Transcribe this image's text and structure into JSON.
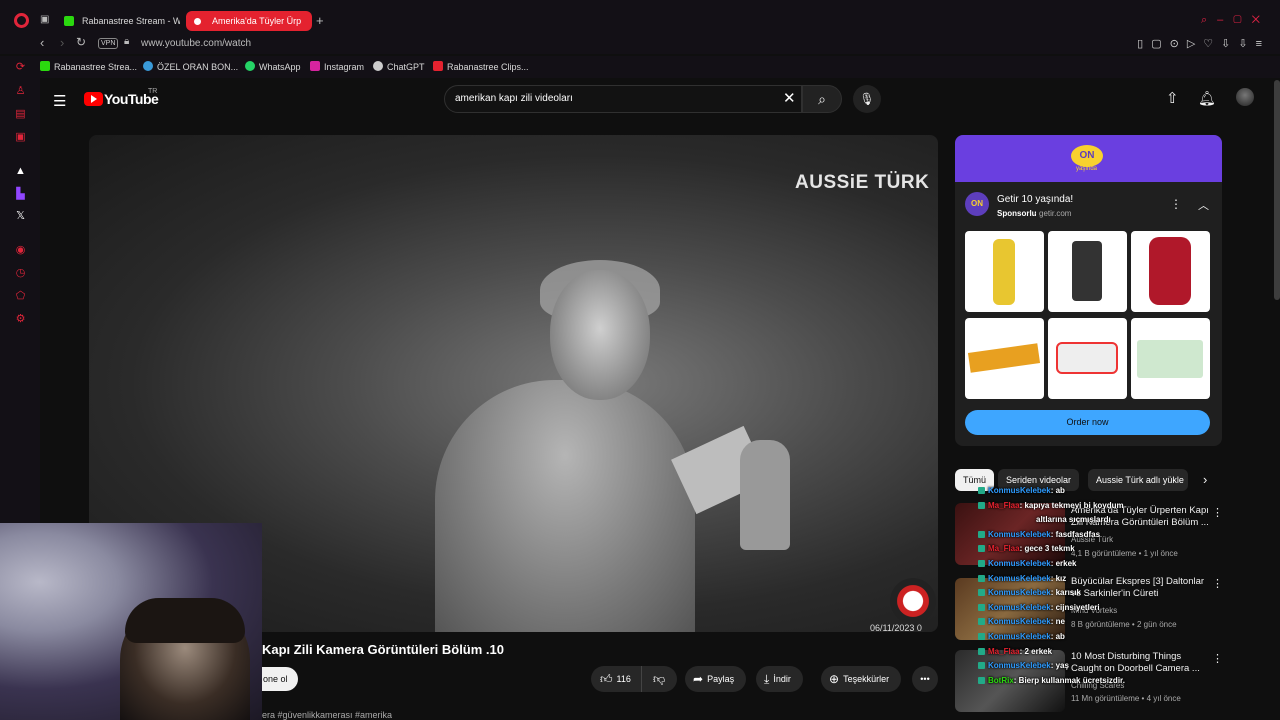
{
  "browser": {
    "tabs": [
      {
        "label": "Rabanastree Stream - Wa",
        "color": "#2bd90f"
      },
      {
        "label": "Amerika'da Tüyler Ürp",
        "color": "#e4222f"
      }
    ],
    "vpn_label": "VPN",
    "url": "www.youtube.com/watch",
    "bookmarks": [
      {
        "label": "Rabanastree Strea...",
        "color": "#2bd90f"
      },
      {
        "label": "ÖZEL ORAN BON...",
        "color": "#3a9ad9"
      },
      {
        "label": "WhatsApp",
        "color": "#25d366"
      },
      {
        "label": "Instagram",
        "color": "#d6249f"
      },
      {
        "label": "ChatGPT",
        "color": "#cccccc"
      },
      {
        "label": "Rabanastree Clips...",
        "color": "#e4222f"
      }
    ]
  },
  "youtube": {
    "logo_text": "YouTube",
    "country_code": "TR",
    "search_query": "amerikan kapı zili videoları",
    "video": {
      "watermark": "AUSSiE TÜRK",
      "overlay_timestamp": "06/11/2023 0",
      "title": "Kapı Zili Kamera Görüntüleri Bölüm .10",
      "subscribe_label": "Abone ol",
      "subscribe_visible": "one ol",
      "likes": "116",
      "share_label": "Paylaş",
      "download_label": "İndir",
      "thanks_label": "Teşekkürler",
      "description": "era #güvenlikkamerası #amerika"
    },
    "ad": {
      "banner_logo": "ON",
      "banner_sub": "yaşında",
      "title": "Getir 10 yaşında!",
      "sponsored": "Sponsorlu",
      "domain": "getir.com",
      "cta": "Order now"
    },
    "chips": [
      "Tümü",
      "Seriden videolar",
      "Aussie Türk adlı yükle"
    ],
    "related": [
      {
        "title": "Amerika'da Tüyler Ürperten Kapı Zili Kamera Görüntüleri Bölüm ...",
        "channel": "Aussie Türk",
        "meta": "4,1 B görüntüleme • 1 yıl önce"
      },
      {
        "title": "Büyücülar Ekspres [3] Daltonlar ve Sarkinler'in Cüreti",
        "channel": "Mind Vorteks",
        "meta": "8 B görüntüleme • 2 gün önce"
      },
      {
        "title": "10 Most Disturbing Things Caught on Doorbell Camera ...",
        "channel": "Chilling Scares",
        "meta": "11 Mn görüntüleme • 4 yıl önce"
      }
    ]
  },
  "chat": [
    {
      "user": "KonmusKelebek",
      "text": ": ab",
      "color": "#2e9cff"
    },
    {
      "user": "Ma_Flaa",
      "text": ": kapıya tekmeyi bi koydum",
      "color": "#e4222f"
    },
    {
      "user": "",
      "text": "altlarına sıçmışlardı",
      "color": "#ffffff"
    },
    {
      "user": "KonmusKelebek",
      "text": ": fasdfasdfas",
      "color": "#2e9cff"
    },
    {
      "user": "Ma_Flaa",
      "text": ": gece 3 tekmk",
      "color": "#e4222f"
    },
    {
      "user": "KonmusKelebek",
      "text": ": erkek",
      "color": "#2e9cff"
    },
    {
      "user": "KonmusKelebek",
      "text": ": kız",
      "color": "#2e9cff"
    },
    {
      "user": "KonmusKelebek",
      "text": ": karısık",
      "color": "#2e9cff"
    },
    {
      "user": "KonmusKelebek",
      "text": ": cijnsiyetleri",
      "color": "#2e9cff"
    },
    {
      "user": "KonmusKelebek",
      "text": ": ne",
      "color": "#2e9cff"
    },
    {
      "user": "KonmusKelebek",
      "text": ": ab",
      "color": "#2e9cff"
    },
    {
      "user": "Ma_Flaa",
      "text": ": 2 erkek",
      "color": "#e4222f"
    },
    {
      "user": "KonmusKelebek",
      "text": ": yaş",
      "color": "#2e9cff"
    },
    {
      "user": "BotRix",
      "text": ": Bierp kullanmak ücretsizdir.",
      "color": "#2bd90f"
    }
  ]
}
